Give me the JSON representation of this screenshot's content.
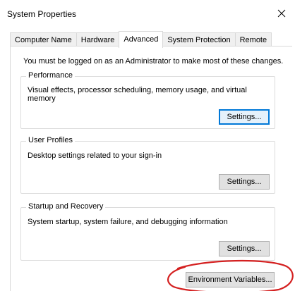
{
  "window": {
    "title": "System Properties"
  },
  "tabs": [
    {
      "label": "Computer Name",
      "active": false
    },
    {
      "label": "Hardware",
      "active": false
    },
    {
      "label": "Advanced",
      "active": true
    },
    {
      "label": "System Protection",
      "active": false
    },
    {
      "label": "Remote",
      "active": false
    }
  ],
  "advanced": {
    "admin_note": "You must be logged on as an Administrator to make most of these changes.",
    "performance": {
      "title": "Performance",
      "description": "Visual effects, processor scheduling, memory usage, and virtual memory",
      "button_label": "Settings..."
    },
    "user_profiles": {
      "title": "User Profiles",
      "description": "Desktop settings related to your sign-in",
      "button_label": "Settings..."
    },
    "startup_recovery": {
      "title": "Startup and Recovery",
      "description": "System startup, system failure, and debugging information",
      "button_label": "Settings..."
    },
    "env_button_label": "Environment Variables..."
  },
  "colors": {
    "focus_border": "#0078d7",
    "annotation_red": "#d42020"
  },
  "icons": {
    "close": "close-icon"
  }
}
